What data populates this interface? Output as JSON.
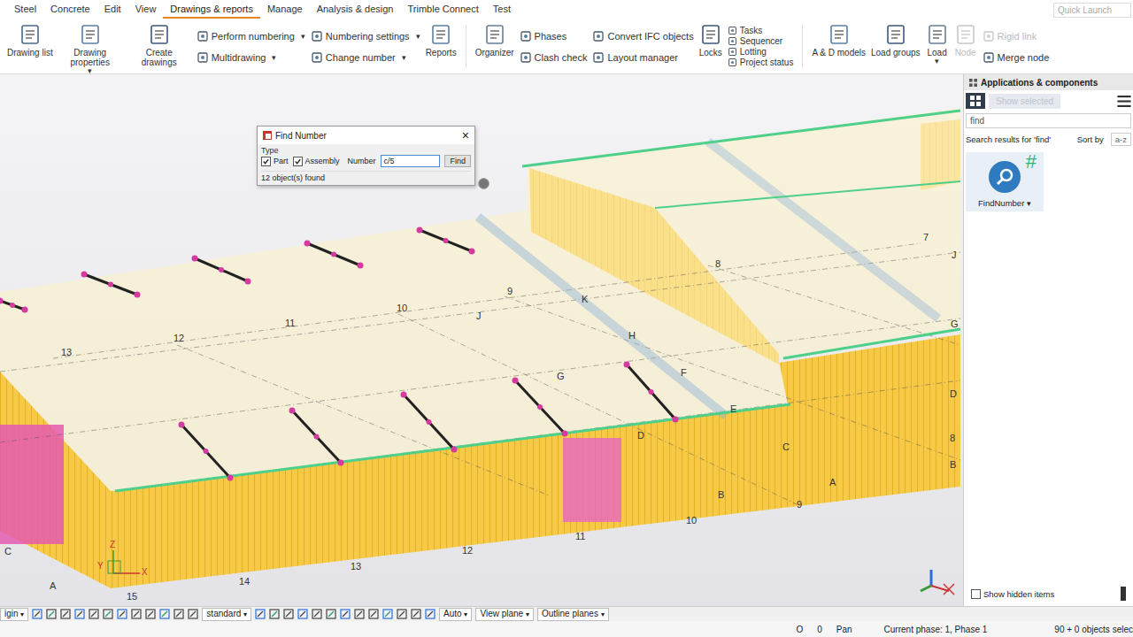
{
  "menu_tabs": [
    {
      "label": "Steel",
      "selected": false
    },
    {
      "label": "Concrete",
      "selected": false
    },
    {
      "label": "Edit",
      "selected": false
    },
    {
      "label": "View",
      "selected": false
    },
    {
      "label": "Drawings & reports",
      "selected": true
    },
    {
      "label": "Manage",
      "selected": false
    },
    {
      "label": "Analysis & design",
      "selected": false
    },
    {
      "label": "Trimble Connect",
      "selected": false
    },
    {
      "label": "Test",
      "selected": false
    }
  ],
  "quick_launch": {
    "placeholder": "Quick Launch"
  },
  "ribbon": [
    {
      "kind": "large",
      "label": "Drawing list",
      "disabled": false,
      "arrow": ""
    },
    {
      "kind": "large",
      "label": "Drawing properties",
      "disabled": false,
      "arrow": "▾"
    },
    {
      "kind": "large",
      "label": "Create drawings",
      "disabled": false,
      "arrow": ""
    },
    {
      "kind": "stack",
      "items": [
        {
          "label": "Perform numbering",
          "disabled": false,
          "arrow": "▾"
        },
        {
          "label": "Multidrawing",
          "disabled": false,
          "arrow": "▾"
        }
      ]
    },
    {
      "kind": "stack",
      "items": [
        {
          "label": "Numbering settings",
          "disabled": false,
          "arrow": "▾"
        },
        {
          "label": "Change number",
          "disabled": false,
          "arrow": "▾"
        }
      ]
    },
    {
      "kind": "large",
      "label": "Reports",
      "disabled": false,
      "arrow": ""
    },
    {
      "kind": "separator"
    },
    {
      "kind": "large",
      "label": "Organizer",
      "disabled": false,
      "arrow": ""
    },
    {
      "kind": "stack",
      "items": [
        {
          "label": "Phases",
          "disabled": false,
          "arrow": ""
        },
        {
          "label": "Clash check",
          "disabled": false,
          "arrow": ""
        }
      ]
    },
    {
      "kind": "stack",
      "items": [
        {
          "label": "Convert IFC objects",
          "disabled": false,
          "arrow": ""
        },
        {
          "label": "Layout manager",
          "disabled": false,
          "arrow": ""
        }
      ]
    },
    {
      "kind": "large",
      "label": "Locks",
      "disabled": false,
      "arrow": ""
    },
    {
      "kind": "mini",
      "items": [
        {
          "label": "Tasks",
          "disabled": false,
          "arrow": ""
        },
        {
          "label": "Sequencer",
          "disabled": false,
          "arrow": ""
        },
        {
          "label": "Lotting",
          "disabled": false,
          "arrow": ""
        },
        {
          "label": "Project status",
          "disabled": false,
          "arrow": ""
        }
      ]
    },
    {
      "kind": "separator"
    },
    {
      "kind": "large",
      "label": "A & D models",
      "disabled": false,
      "arrow": ""
    },
    {
      "kind": "large",
      "label": "Load groups",
      "disabled": false,
      "arrow": ""
    },
    {
      "kind": "large",
      "label": "Load",
      "disabled": false,
      "arrow": "▾"
    },
    {
      "kind": "large",
      "label": "Node",
      "disabled": true,
      "arrow": ""
    },
    {
      "kind": "stack",
      "items": [
        {
          "label": "Rigid link",
          "disabled": true,
          "arrow": ""
        },
        {
          "label": "Merge node",
          "disabled": false,
          "arrow": ""
        }
      ]
    }
  ],
  "find_dialog": {
    "title": "Find Number",
    "close": "×",
    "type_label": "Type",
    "checkboxes": [
      {
        "label": "Part",
        "checked": true
      },
      {
        "label": "Assembly",
        "checked": true
      }
    ],
    "number_label": "Number",
    "number_value": "c/5",
    "button": "Find",
    "result": "12 object(s) found"
  },
  "viewport": {
    "grid_labels": [
      "7",
      "8",
      "9",
      "10",
      "11",
      "12",
      "13",
      "J",
      "K",
      "H",
      "G",
      "F",
      "E",
      "D",
      "C",
      "B",
      "A",
      "J",
      "G",
      "D",
      "8",
      "B",
      "9",
      "10",
      "11",
      "12",
      "13",
      "14",
      "15",
      "C",
      "A"
    ],
    "axis_labels": [
      "Z",
      "Y",
      "X"
    ]
  },
  "side_panel": {
    "title": "Applications & components",
    "show_selected": {
      "label": "Show selected",
      "disabled": true
    },
    "search_value": "find",
    "results_label": "Search results for 'find'",
    "sort_label": "Sort by",
    "sort_value": "a-z",
    "items": [
      {
        "label": "FindNumber",
        "arrow": "▾",
        "badge": "#"
      }
    ],
    "show_hidden": {
      "label": "Show hidden items",
      "checked": false
    }
  },
  "bottom_toolbar": {
    "dropdowns": [
      {
        "label": "igin",
        "arrow": "▾"
      },
      {
        "label": "standard",
        "arrow": "▾"
      },
      {
        "label": "Auto",
        "arrow": "▾"
      },
      {
        "label": "View plane",
        "arrow": "▾"
      },
      {
        "label": "Outline planes",
        "arrow": "▾"
      }
    ]
  },
  "status_bar": [
    "O",
    "0",
    "Pan",
    "Current phase: 1, Phase 1",
    "90 + 0 objects selec"
  ]
}
